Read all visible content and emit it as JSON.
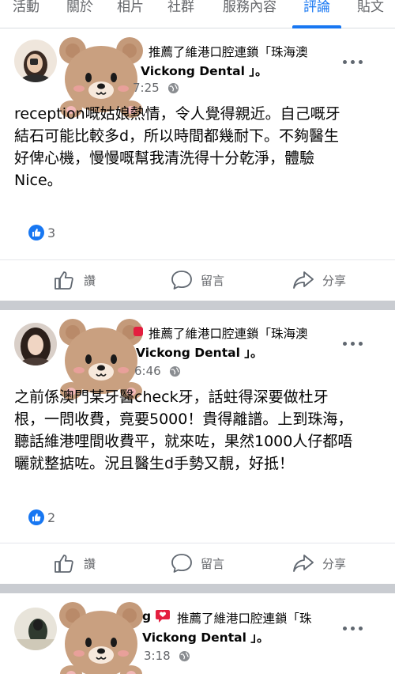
{
  "tabs": [
    {
      "label": "活動"
    },
    {
      "label": "關於"
    },
    {
      "label": "相片"
    },
    {
      "label": "社群"
    },
    {
      "label": "服務內容"
    },
    {
      "label": "評論",
      "active": true
    },
    {
      "label": "貼文"
    }
  ],
  "colors": {
    "accent": "#1877f2",
    "divider": "#c9ccd1",
    "secondary_text": "#65676b"
  },
  "posts": [
    {
      "head_line1": "推薦了維港口腔連鎖「珠海澳",
      "head_line2": "Vickong Dental 」。",
      "time": "7:25",
      "body_lines": [
        "reception嘅姑娘熱情，令人覺得親近。自己嘅牙",
        "結石可能比較多d，所以時間都幾耐下。不夠醫生",
        "好俾心機，慢慢嘅幫我清洗得十分乾淨，體驗",
        "Nice。"
      ],
      "likes": "3"
    },
    {
      "head_line1": "推薦了維港口腔連鎖「珠海澳",
      "head_line2": "Vickong Dental 」。",
      "time": "6:46",
      "body_lines": [
        "之前係澳門某牙醫check牙，話蛀得深要做杜牙",
        "根，一問收費，竟要5000！貴得離譜。上到珠海，",
        "聽話維港哩間收費平，就來咗，果然1000人仔都唔",
        "曬就整掂咗。況且醫生d手勢又靚，好抵！"
      ],
      "likes": "2"
    },
    {
      "name_fragment": "g",
      "head_line1": "推薦了維港口腔連鎖「珠",
      "head_line2": "Vickong Dental 」。",
      "time": "3:18"
    }
  ],
  "actions": {
    "like": "讚",
    "comment": "留言",
    "share": "分享"
  },
  "icons": [
    "like-icon",
    "comment-icon",
    "share-icon",
    "globe-icon",
    "more-options-icon",
    "recommend-icon",
    "bear-sticker"
  ]
}
